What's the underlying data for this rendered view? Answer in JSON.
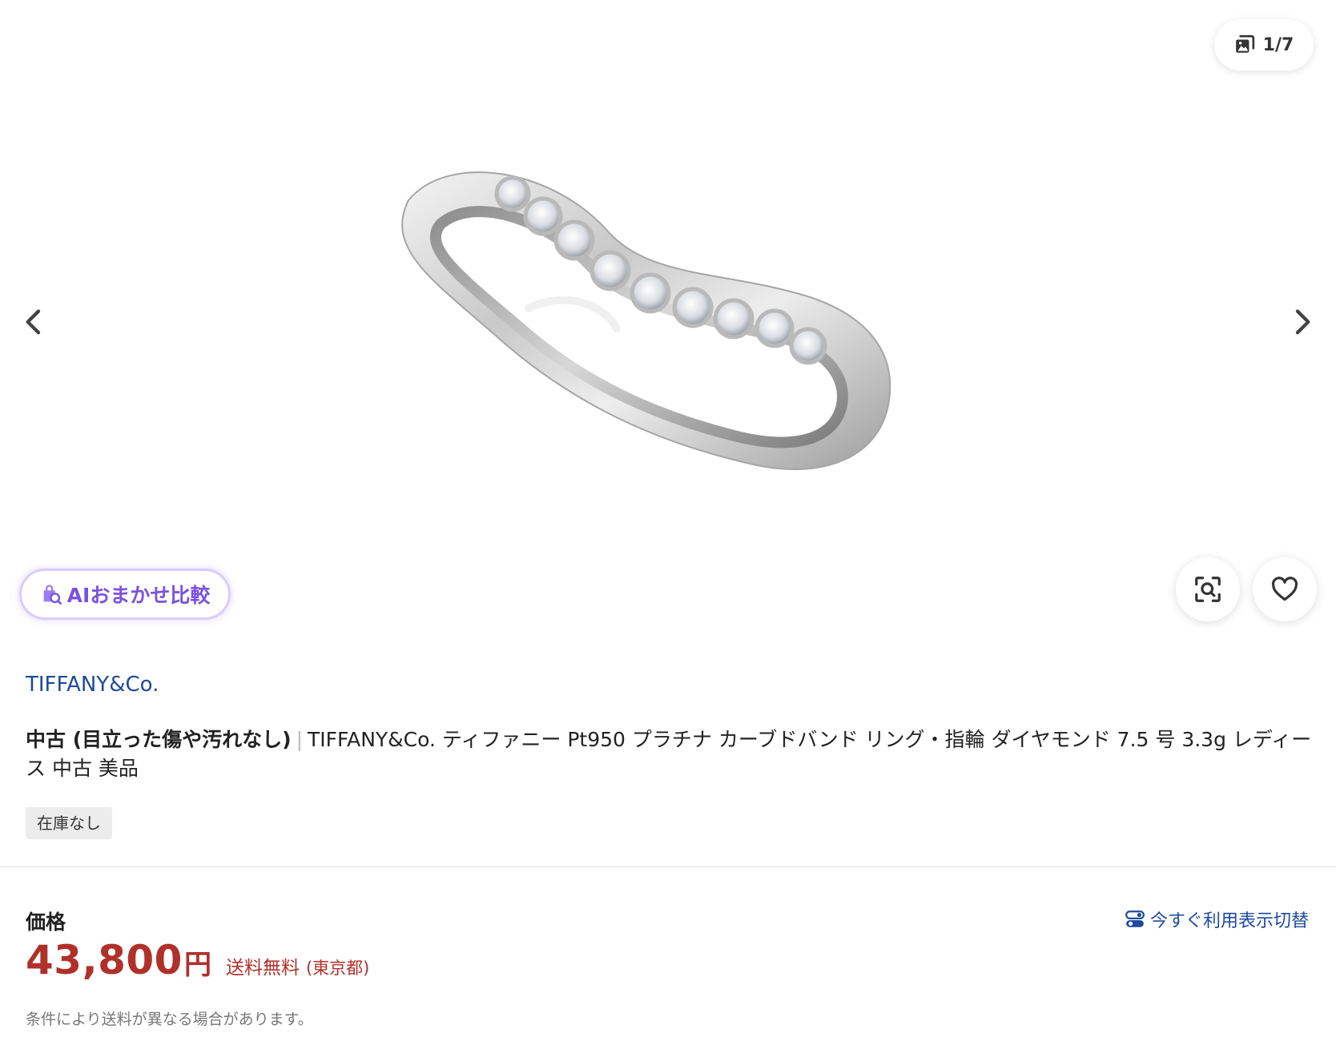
{
  "gallery": {
    "counter": "1/7",
    "current_index": 1,
    "total_images": 7,
    "ai_compare_label": "AIおまかせ比較",
    "icons": {
      "counter": "image-stack-icon",
      "prev": "chevron-left-icon",
      "next": "chevron-right-icon",
      "ai": "ai-bag-search-icon",
      "lens": "image-search-icon",
      "favorite": "heart-icon"
    }
  },
  "product": {
    "brand": "TIFFANY&Co.",
    "condition": "中古 (目立った傷や汚れなし)",
    "separator": "|",
    "title": "TIFFANY&Co. ティファニー Pt950 プラチナ カーブドバンド リング・指輪 ダイヤモンド 7.5 号 3.3g レディース 中古 美品",
    "stock_status": "在庫なし"
  },
  "pricing": {
    "label": "価格",
    "amount": "43,800",
    "currency": "円",
    "shipping": "送料無料",
    "location": "(東京都)",
    "toggle_label": "今すぐ利用表示切替",
    "note": "条件により送料が異なる場合があります。"
  },
  "colors": {
    "price": "#b0302a",
    "link": "#1d4a9c",
    "ai_accent": "#7a52e0"
  }
}
